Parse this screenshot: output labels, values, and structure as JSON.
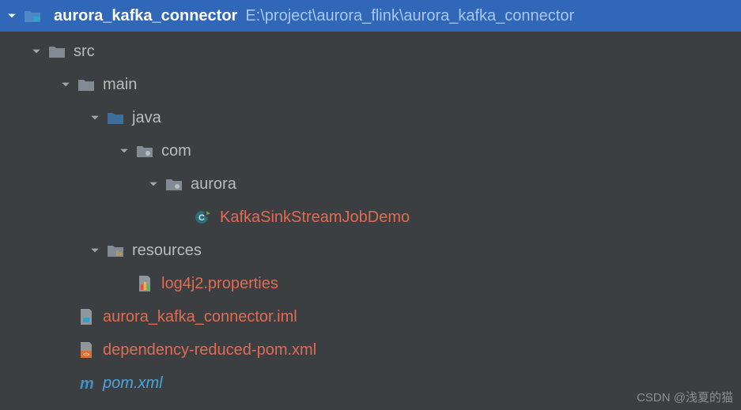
{
  "root": {
    "name": "aurora_kafka_connector",
    "path": "E:\\project\\aurora_flink\\aurora_kafka_connector"
  },
  "tree": {
    "src": {
      "label": "src"
    },
    "main": {
      "label": "main"
    },
    "java": {
      "label": "java"
    },
    "com": {
      "label": "com"
    },
    "aurora": {
      "label": "aurora"
    },
    "kafkaClass": {
      "label": "KafkaSinkStreamJobDemo"
    },
    "resources": {
      "label": "resources"
    },
    "log4j2": {
      "label": "log4j2.properties"
    },
    "iml": {
      "label": "aurora_kafka_connector.iml"
    },
    "depPom": {
      "label": "dependency-reduced-pom.xml"
    },
    "pom": {
      "label": "pom.xml"
    }
  },
  "watermark": "CSDN @浅夏的猫",
  "indent": 37
}
